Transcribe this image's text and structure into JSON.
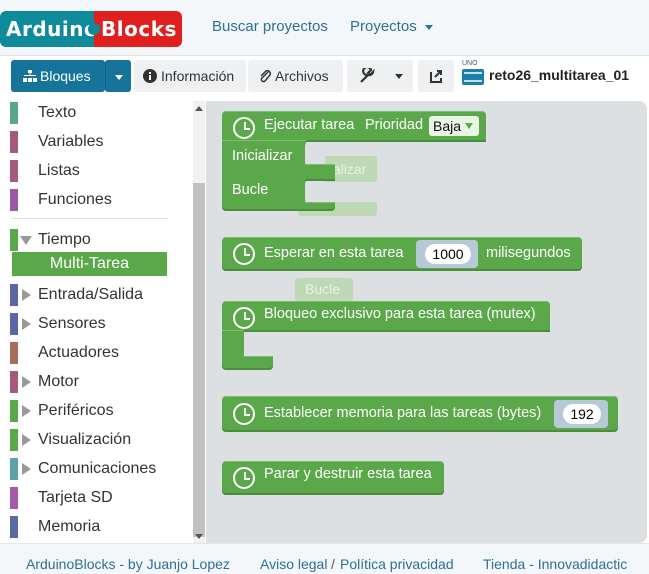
{
  "logo": {
    "part1": "Arduino",
    "part2": "Blocks"
  },
  "nav": {
    "search": "Buscar proyectos",
    "projects": "Proyectos"
  },
  "toolbar": {
    "blocks_label": "Bloques",
    "info_label": "Información",
    "files_label": "Archivos",
    "board_badge": "UNO",
    "project_name": "reto26_multitarea_01"
  },
  "sidebar": {
    "items": [
      {
        "label": "Texto",
        "color": "#5ba58c"
      },
      {
        "label": "Variables",
        "color": "#a55b80"
      },
      {
        "label": "Listas",
        "color": "#a55b80"
      },
      {
        "label": "Funciones",
        "color": "#995ba5"
      },
      {
        "label": "Tiempo",
        "color": "#5ba84b",
        "expanded": true
      },
      {
        "label": "Multi-Tarea",
        "selected": true
      },
      {
        "label": "Entrada/Salida",
        "color": "#5b67a5"
      },
      {
        "label": "Sensores",
        "color": "#5b67a5"
      },
      {
        "label": "Actuadores",
        "color": "#a56d5b"
      },
      {
        "label": "Motor",
        "color": "#a55b80"
      },
      {
        "label": "Periféricos",
        "color": "#5ba84b"
      },
      {
        "label": "Visualización",
        "color": "#5ba84b"
      },
      {
        "label": "Comunicaciones",
        "color": "#5ba5a5"
      },
      {
        "label": "Tarjeta SD",
        "color": "#a55bab"
      },
      {
        "label": "Memoria",
        "color": "#5b6aa5"
      }
    ]
  },
  "blocks": {
    "task": {
      "label": "Ejecutar tarea",
      "priority_label": "Prioridad",
      "priority_value": "Baja",
      "init_label": "Inicializar",
      "loop_label": "Bucle"
    },
    "wait": {
      "label": "Esperar en esta tarea",
      "value": "1000",
      "unit": "milisegundos"
    },
    "mutex": {
      "label": "Bloqueo exclusivo para esta tarea (mutex)"
    },
    "memory": {
      "label": "Establecer memoria para las tareas (bytes)",
      "value": "192"
    },
    "stop": {
      "label": "Parar y destruir esta tarea"
    },
    "ghost_init": "Inicializar",
    "ghost_loop": "Bucle"
  },
  "footer": {
    "credit": "ArduinoBlocks - by Juanjo Lopez",
    "legal": "Aviso legal",
    "separator": "/",
    "privacy": "Política privacidad",
    "store": "Tienda - Innovadidactic"
  }
}
